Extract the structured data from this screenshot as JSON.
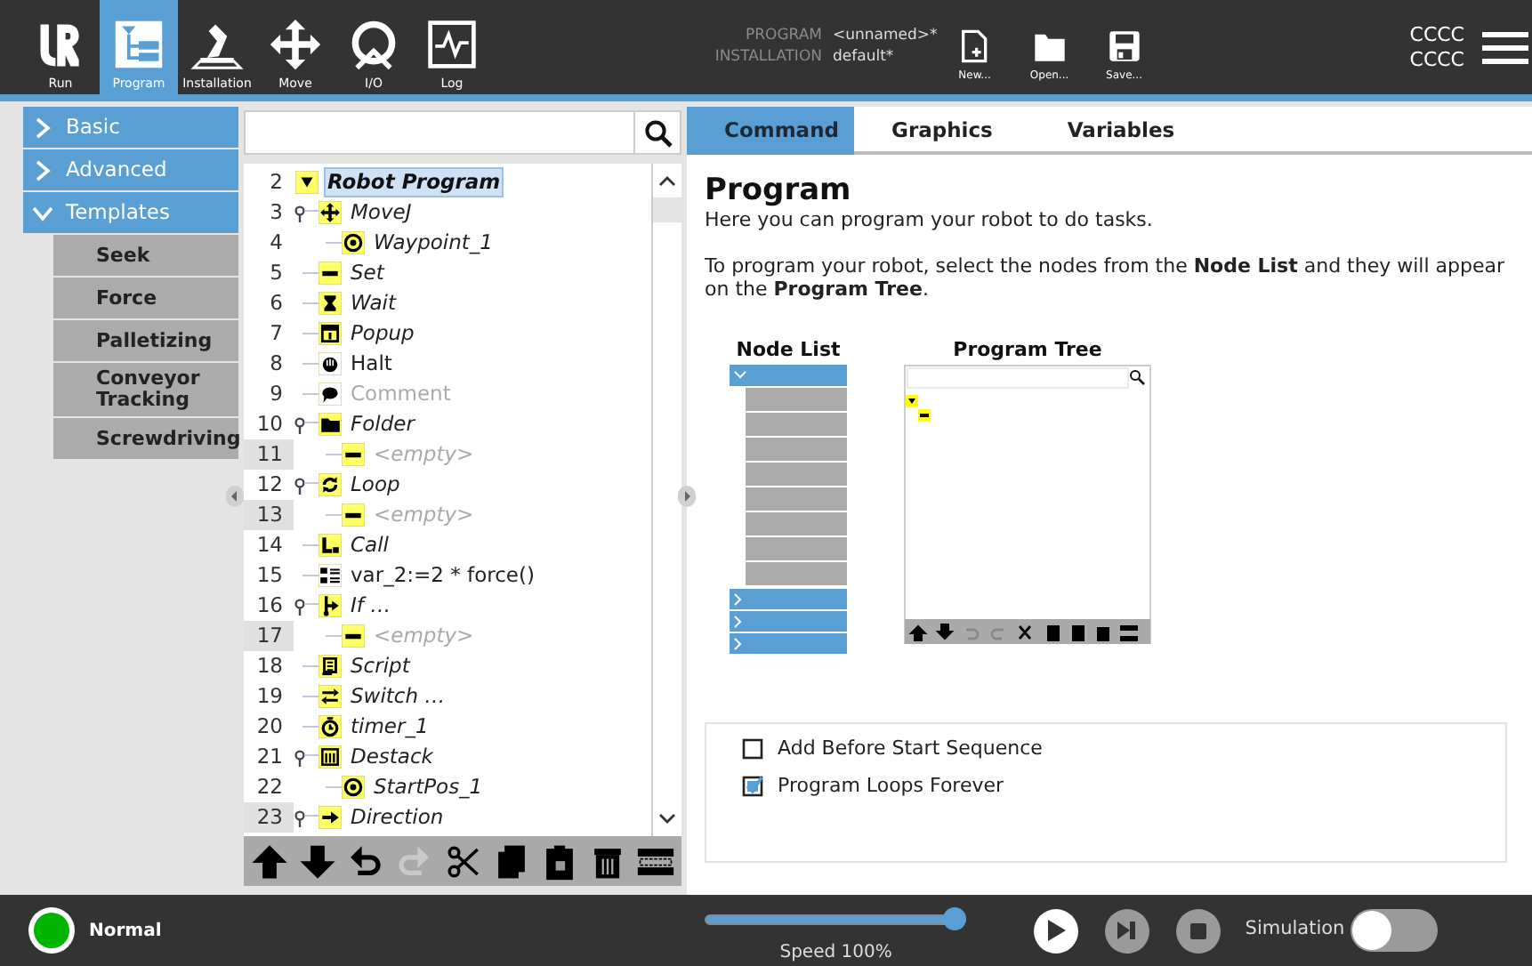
{
  "top_bar": {
    "nav": [
      {
        "label": "Run",
        "kind": "logo",
        "selected": false
      },
      {
        "label": "Program",
        "kind": "program",
        "selected": true
      },
      {
        "label": "Installation",
        "kind": "installation",
        "selected": false
      },
      {
        "label": "Move",
        "kind": "move",
        "selected": false
      },
      {
        "label": "I/O",
        "kind": "io",
        "selected": false
      },
      {
        "label": "Log",
        "kind": "log",
        "selected": false
      }
    ],
    "program_label": "PROGRAM",
    "program_value": "<unnamed>*",
    "installation_label": "INSTALLATION",
    "installation_value": "default*",
    "file_actions": [
      {
        "label": "New...",
        "kind": "new"
      },
      {
        "label": "Open...",
        "kind": "open"
      },
      {
        "label": "Save...",
        "kind": "save"
      }
    ],
    "status_lines": [
      "CCCC",
      "CCCC"
    ]
  },
  "node_categories": [
    {
      "label": "Basic",
      "expanded": false
    },
    {
      "label": "Advanced",
      "expanded": false
    },
    {
      "label": "Templates",
      "expanded": true,
      "children": [
        {
          "label": "Seek"
        },
        {
          "label": "Force"
        },
        {
          "label": "Palletizing"
        },
        {
          "label": "Conveyor Tracking"
        },
        {
          "label": "Screwdriving"
        }
      ]
    }
  ],
  "program_tree": {
    "nodes": [
      {
        "number": "2",
        "label": "Robot Program",
        "kind": "root",
        "marked": false,
        "selected": true,
        "children": [
          {
            "number": "3",
            "label": "MoveJ",
            "kind": "move",
            "marked": false,
            "selected": false,
            "expanded": true,
            "children": [
              {
                "number": "4",
                "label": "Waypoint_1",
                "kind": "waypoint",
                "marked": false,
                "selected": false,
                "expanded": false
              }
            ]
          },
          {
            "number": "5",
            "label": "Set",
            "kind": "set",
            "marked": false,
            "selected": false,
            "expanded": false
          },
          {
            "number": "6",
            "label": "Wait",
            "kind": "wait",
            "marked": false,
            "selected": false,
            "expanded": false
          },
          {
            "number": "7",
            "label": "Popup",
            "kind": "popup",
            "marked": false,
            "selected": false,
            "expanded": false
          },
          {
            "number": "8",
            "label": "Halt",
            "kind": "halt",
            "marked": false,
            "selected": false,
            "expanded": false
          },
          {
            "number": "9",
            "label": "Comment",
            "kind": "comment",
            "marked": false,
            "selected": false,
            "expanded": false
          },
          {
            "number": "10",
            "label": "Folder",
            "kind": "folder",
            "marked": false,
            "selected": false,
            "expanded": true,
            "children": [
              {
                "number": "11",
                "label": "<empty>",
                "kind": "empty",
                "marked": true,
                "selected": false,
                "expanded": false
              }
            ]
          },
          {
            "number": "12",
            "label": "Loop",
            "kind": "loop",
            "marked": false,
            "selected": false,
            "expanded": true,
            "children": [
              {
                "number": "13",
                "label": "<empty>",
                "kind": "empty",
                "marked": true,
                "selected": false,
                "expanded": false
              }
            ]
          },
          {
            "number": "14",
            "label": "Call",
            "kind": "call",
            "marked": false,
            "selected": false,
            "expanded": false
          },
          {
            "number": "15",
            "label": "var_2:=2 * force()",
            "kind": "assign",
            "marked": false,
            "selected": false,
            "expanded": false
          },
          {
            "number": "16",
            "label": "If …",
            "kind": "if",
            "marked": false,
            "selected": false,
            "expanded": true,
            "children": [
              {
                "number": "17",
                "label": "<empty>",
                "kind": "empty",
                "marked": true,
                "selected": false,
                "expanded": false
              }
            ]
          },
          {
            "number": "18",
            "label": "Script",
            "kind": "script",
            "marked": false,
            "selected": false,
            "expanded": false
          },
          {
            "number": "19",
            "label": "Switch …",
            "kind": "switch",
            "marked": false,
            "selected": false,
            "expanded": false
          },
          {
            "number": "20",
            "label": "timer_1",
            "kind": "timer",
            "marked": false,
            "selected": false,
            "expanded": false
          },
          {
            "number": "21",
            "label": "Destack",
            "kind": "destack",
            "marked": false,
            "selected": false,
            "expanded": true,
            "children": [
              {
                "number": "22",
                "label": "StartPos_1",
                "kind": "waypoint",
                "marked": false,
                "selected": false,
                "expanded": false
              }
            ]
          },
          {
            "number": "23",
            "label": "Direction",
            "kind": "direction",
            "marked": true,
            "selected": false,
            "expanded": true
          }
        ]
      }
    ],
    "toolbar": [
      {
        "kind": "up",
        "disabled": false
      },
      {
        "kind": "down",
        "disabled": false
      },
      {
        "kind": "undo",
        "disabled": false
      },
      {
        "kind": "redo",
        "disabled": true
      },
      {
        "kind": "cut",
        "disabled": false
      },
      {
        "kind": "copy",
        "disabled": false
      },
      {
        "kind": "paste",
        "disabled": false
      },
      {
        "kind": "delete",
        "disabled": false
      },
      {
        "kind": "suppress",
        "disabled": false
      }
    ]
  },
  "tabs": [
    {
      "label": "Command",
      "selected": true
    },
    {
      "label": "Graphics",
      "selected": false
    },
    {
      "label": "Variables",
      "selected": false
    }
  ],
  "command": {
    "title": "Program",
    "intro": "Here you can program your robot to do tasks.",
    "instructions": "To program your robot, select the nodes from the **Node List** and they will appear on the **Program Tree**.",
    "node_list_label": "Node List",
    "program_tree_label": "Program Tree",
    "options": [
      {
        "label": "Add Before Start Sequence",
        "checked": false
      },
      {
        "label": "Program Loops Forever",
        "checked": true
      }
    ]
  },
  "bottom_bar": {
    "status": {
      "label": "Normal",
      "color": "#00b400"
    },
    "speed": {
      "level": 1,
      "reading": "Speed 100%"
    },
    "controls": [
      {
        "kind": "play",
        "disabled": false
      },
      {
        "kind": "step",
        "disabled": true
      },
      {
        "kind": "stop",
        "disabled": true
      }
    ],
    "simulation": {
      "label": "Simulation",
      "on": false
    }
  }
}
